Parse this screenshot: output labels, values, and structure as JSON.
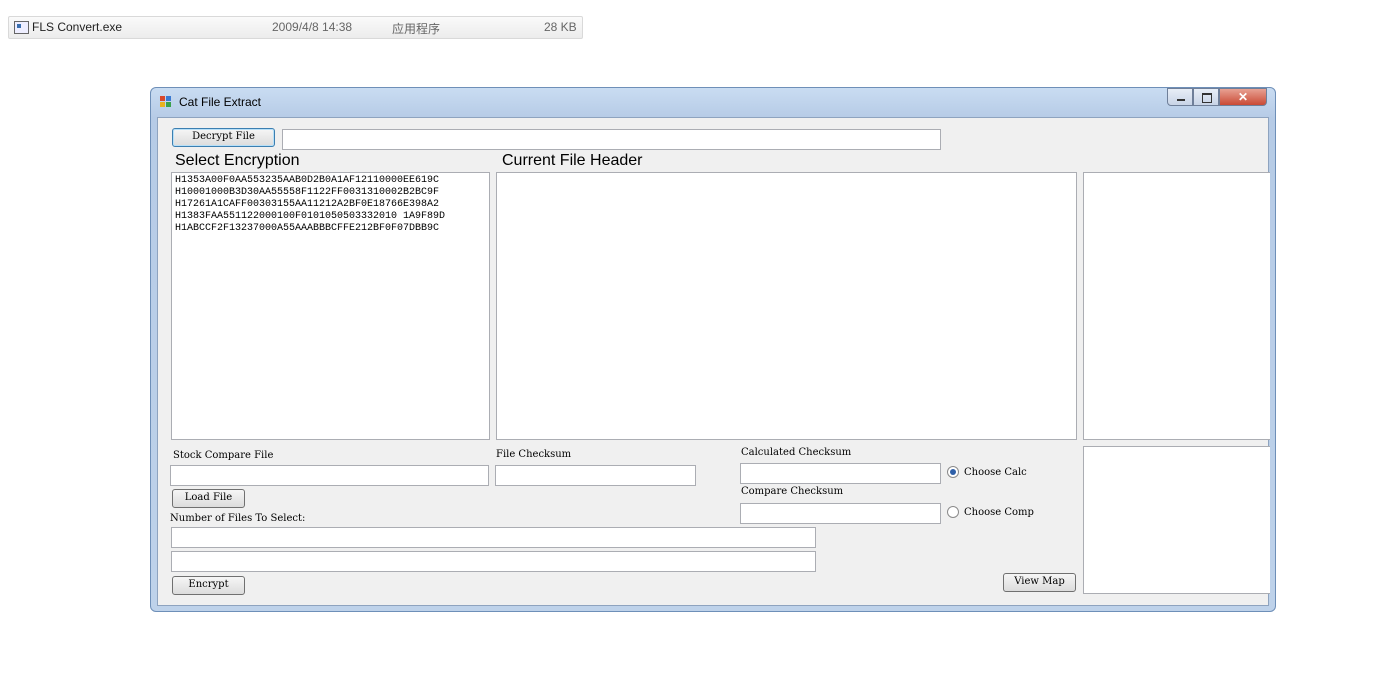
{
  "explorer_row": {
    "filename": "FLS Convert.exe",
    "date": "2009/4/8 14:38",
    "type": "应用程序",
    "size": "28 KB"
  },
  "window": {
    "title": "Cat File Extract",
    "close_glyph": "✕"
  },
  "decrypt_button": "Decrypt File",
  "decrypt_path": "",
  "select_encryption": {
    "heading": "Select Encryption",
    "items": [
      "H1353A00F0AA553235AAB0D2B0A1AF12110000EE619C",
      "H10001000B3D30AA55558F1122FF0031310002B2BC9F",
      "H17261A1CAFF00303155AA11212A2BF0E18766E398A2",
      "H1383FAA551122000100F0101050503332010 1A9F89D",
      "H1ABCCF2F13237000A55AAABBBCFFE212BF0F07DBB9C"
    ]
  },
  "current_file_header": {
    "heading": "Current File Header"
  },
  "stock_compare_label": "Stock Compare File",
  "file_checksum_label": "File Checksum",
  "calculated_checksum_label": "Calculated Checksum",
  "compare_checksum_label": "Compare Checksum",
  "choose_calc_label": "Choose Calc",
  "choose_comp_label": "Choose Comp",
  "load_file_button": "Load File",
  "number_of_files_label": "Number of Files To Select:",
  "encrypt_button": "Encrypt",
  "view_map_button": "View Map"
}
